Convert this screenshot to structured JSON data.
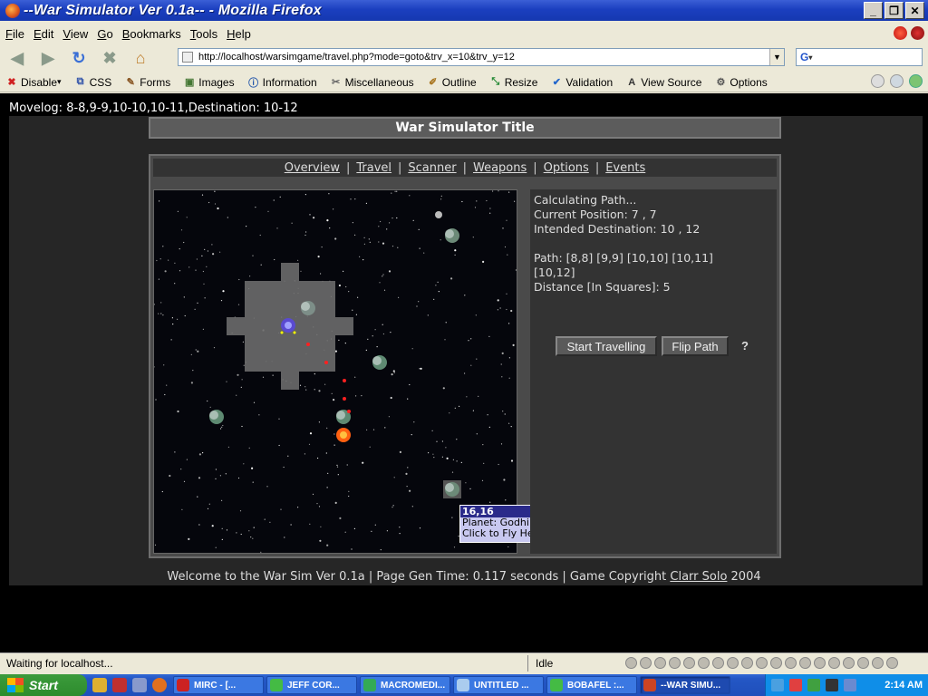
{
  "window": {
    "title": "--War Simulator Ver 0.1a-- - Mozilla Firefox",
    "buttons": [
      "_",
      "❐",
      "✕"
    ]
  },
  "menu": {
    "items": [
      {
        "key": "F",
        "rest": "ile"
      },
      {
        "key": "E",
        "rest": "dit"
      },
      {
        "key": "V",
        "rest": "iew"
      },
      {
        "key": "G",
        "rest": "o"
      },
      {
        "key": "B",
        "rest": "ookmarks"
      },
      {
        "key": "T",
        "rest": "ools"
      },
      {
        "key": "H",
        "rest": "elp"
      }
    ]
  },
  "nav": {
    "url": "http://localhost/warsimgame/travel.php?mode=goto&trv_x=10&trv_y=12",
    "search_engine": "G"
  },
  "devtoolbar": {
    "items": [
      {
        "label": "Disable",
        "icon": "disable-icon",
        "glyph": "✖",
        "color": "#d02020"
      },
      {
        "label": "CSS",
        "icon": "css-icon",
        "glyph": "⧉",
        "color": "#3355aa"
      },
      {
        "label": "Forms",
        "icon": "forms-icon",
        "glyph": "✎",
        "color": "#885522"
      },
      {
        "label": "Images",
        "icon": "images-icon",
        "glyph": "▣",
        "color": "#447733"
      },
      {
        "label": "Information",
        "icon": "information-icon",
        "glyph": "ⓘ",
        "color": "#2255aa"
      },
      {
        "label": "Miscellaneous",
        "icon": "miscellaneous-icon",
        "glyph": "✂",
        "color": "#666666"
      },
      {
        "label": "Outline",
        "icon": "outline-icon",
        "glyph": "✐",
        "color": "#aa7722"
      },
      {
        "label": "Resize",
        "icon": "resize-icon",
        "glyph": "⤡",
        "color": "#228833"
      },
      {
        "label": "Validation",
        "icon": "validation-icon",
        "glyph": "✔",
        "color": "#2266cc"
      },
      {
        "label": "View Source",
        "icon": "view-source-icon",
        "glyph": "A",
        "color": "#333333"
      },
      {
        "label": "Options",
        "icon": "options-icon",
        "glyph": "⚙",
        "color": "#555555"
      }
    ]
  },
  "page": {
    "movelog": "Movelog: 8-8,9-9,10-10,10-11,Destination: 10-12",
    "title": "War Simulator Title",
    "tabs": [
      "Overview",
      "Travel",
      "Scanner",
      "Weapons",
      "Options",
      "Events"
    ],
    "info": {
      "line1": "Calculating Path...",
      "line2": "Current Position: 7 , 7",
      "line3": "Intended Destination: 10 , 12",
      "line4": "Path: [8,8] [9,9] [10,10] [10,11]",
      "line5": "[10,12]",
      "line6": "Distance [In Squares]: 5"
    },
    "buttons": {
      "start": "Start Travelling",
      "flip": "Flip Path",
      "help": "?"
    },
    "tooltip": {
      "coords": "16,16",
      "planet": "Planet: Godhin",
      "action": "Click to Fly Here"
    },
    "footer": {
      "text": "Welcome to the War Sim Ver 0.1a | Page Gen Time: 0.117 seconds | Game Copyright ",
      "author": "Clarr Solo",
      "year": " 2004"
    }
  },
  "status": {
    "left": "Waiting for localhost...",
    "right": "Idle"
  },
  "taskbar": {
    "start": "Start",
    "tasks": [
      {
        "label": "MIRC - [...",
        "color": "#cc2222"
      },
      {
        "label": "JEFF COR...",
        "color": "#44bb44"
      },
      {
        "label": "MACROMEDI...",
        "color": "#33aa55"
      },
      {
        "label": "UNTITLED ...",
        "color": "#aaccee"
      },
      {
        "label": "BOBAFEL :...",
        "color": "#44bb44"
      },
      {
        "label": "--WAR SIMU...",
        "color": "#cc4422"
      }
    ],
    "clock": "2:14 AM"
  },
  "colors": {
    "page_bg": "#262626",
    "panel_bg": "#4a4a4a",
    "path_dot": "#ff2020",
    "tooltip_header": "#2a2a8a",
    "tooltip_body": "#c8c8f0"
  }
}
